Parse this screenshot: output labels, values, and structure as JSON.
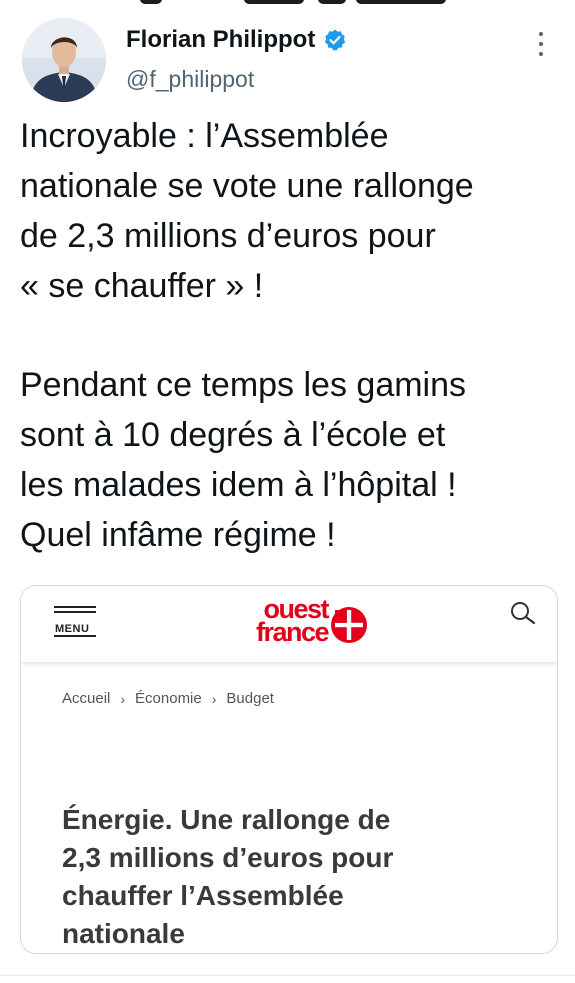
{
  "tweet": {
    "author_name": "Florian Philippot",
    "handle": "@f_philippot",
    "verified": true,
    "text_lines": [
      "Incroyable : l’Assemblée",
      "nationale se vote une rallonge",
      "de 2,3 millions d’euros pour",
      "« se chauffer » !",
      "Pendant ce temps les gamins",
      "sont à 10 degrés à l’école et",
      "les malades idem à l’hôpital !",
      "Quel infâme régime !"
    ]
  },
  "card": {
    "menu_label": "MENU",
    "logo_line1": "ouest",
    "logo_line2": "france",
    "breadcrumb": [
      "Accueil",
      "Économie",
      "Budget"
    ],
    "breadcrumb_separator": "›",
    "title_lines": [
      "Énergie. Une rallonge de",
      "2,3 millions d’euros pour",
      "chauffer l’Assemblée",
      "nationale"
    ]
  },
  "icons": {
    "more": "more-vertical-icon",
    "verified": "verified-badge-icon",
    "menu": "hamburger-menu-icon",
    "search": "search-icon",
    "logo": "ouest-france-logo"
  },
  "colors": {
    "verified_blue": "#1d9bf0",
    "brand_red": "#e2001a",
    "text": "#0f1419",
    "secondary_text": "#536471",
    "card_border": "#cfd9de"
  }
}
